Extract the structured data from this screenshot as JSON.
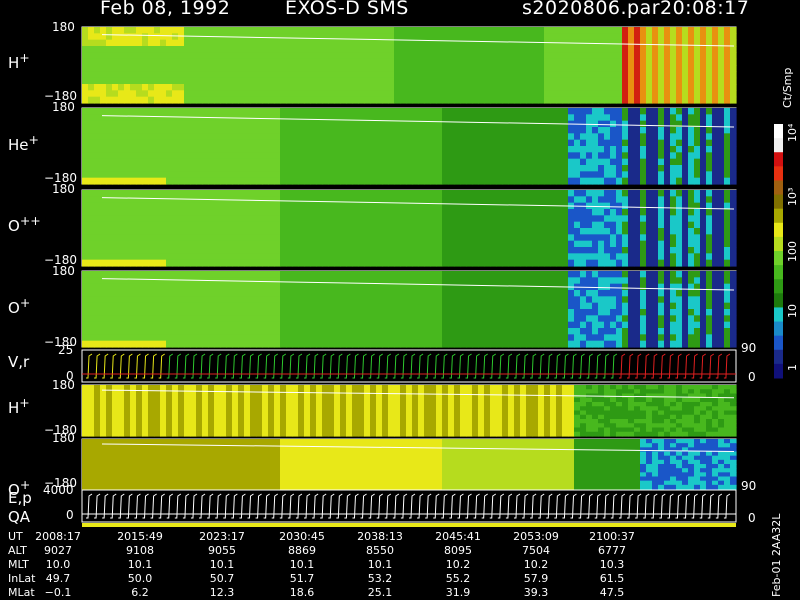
{
  "header": {
    "date": "Feb 08, 1992",
    "instrument": "EXOS-D SMS",
    "file": "s2020806.par",
    "time": "20:08:17"
  },
  "panels": [
    {
      "label": "H",
      "sup": "+",
      "top": "180",
      "bottom": "−180"
    },
    {
      "label": "He",
      "sup": "+",
      "top": "180",
      "bottom": "−180"
    },
    {
      "label": "O",
      "sup": "++",
      "top": "180",
      "bottom": "−180"
    },
    {
      "label": "O",
      "sup": "+",
      "top": "180",
      "bottom": "−180"
    },
    {
      "label": "V,r",
      "sup": "",
      "top": "25",
      "bottom": "0"
    },
    {
      "label": "H",
      "sup": "+",
      "top": "180",
      "bottom": "−180"
    },
    {
      "label": "O",
      "sup": "+",
      "top": "180",
      "bottom": "−180"
    },
    {
      "label": "E,p",
      "sub2": "QA",
      "top": "4000",
      "bottom": "0"
    }
  ],
  "right_axis": {
    "v_panel": {
      "top": "90",
      "bottom": "0"
    },
    "e_panel": {
      "top": "90",
      "bottom": "0"
    }
  },
  "colorbar": {
    "unit": "Ct/Smp",
    "ticks": [
      "10⁴",
      "10³",
      "100",
      "10",
      "1"
    ]
  },
  "table": {
    "rows": [
      {
        "name": "UT",
        "values": [
          "2008:17",
          "2015:49",
          "2023:17",
          "2030:45",
          "2038:13",
          "2045:41",
          "2053:09",
          "2100:37"
        ]
      },
      {
        "name": "ALT",
        "values": [
          "9027",
          "9108",
          "9055",
          "8869",
          "8550",
          "8095",
          "7504",
          "6777"
        ]
      },
      {
        "name": "MLT",
        "values": [
          "10.0",
          "10.1",
          "10.1",
          "10.1",
          "10.1",
          "10.2",
          "10.2",
          "10.3"
        ]
      },
      {
        "name": "InLat",
        "values": [
          "49.7",
          "50.0",
          "50.7",
          "51.7",
          "53.2",
          "55.2",
          "57.9",
          "61.5"
        ]
      },
      {
        "name": "MLat",
        "values": [
          "−0.1",
          "6.2",
          "12.3",
          "18.6",
          "25.1",
          "31.9",
          "39.3",
          "47.5"
        ]
      }
    ]
  },
  "footer_id": "Feb-01 2AA32L",
  "chart_data": {
    "type": "heatmap",
    "title": "Feb 08, 1992   EXOS-D SMS",
    "panels": [
      "H+",
      "He+",
      "O++",
      "O+",
      "V,r",
      "H+",
      "O+",
      "E,p QA"
    ],
    "y_range": [
      -180,
      180
    ],
    "color_scale": "log",
    "color_ticks": [
      "1",
      "10",
      "100",
      "10³",
      "10⁴"
    ],
    "x_ticks": [
      "2008:17",
      "2015:49",
      "2023:17",
      "2030:45",
      "2038:13",
      "2045:41",
      "2053:09",
      "2100:37"
    ]
  }
}
